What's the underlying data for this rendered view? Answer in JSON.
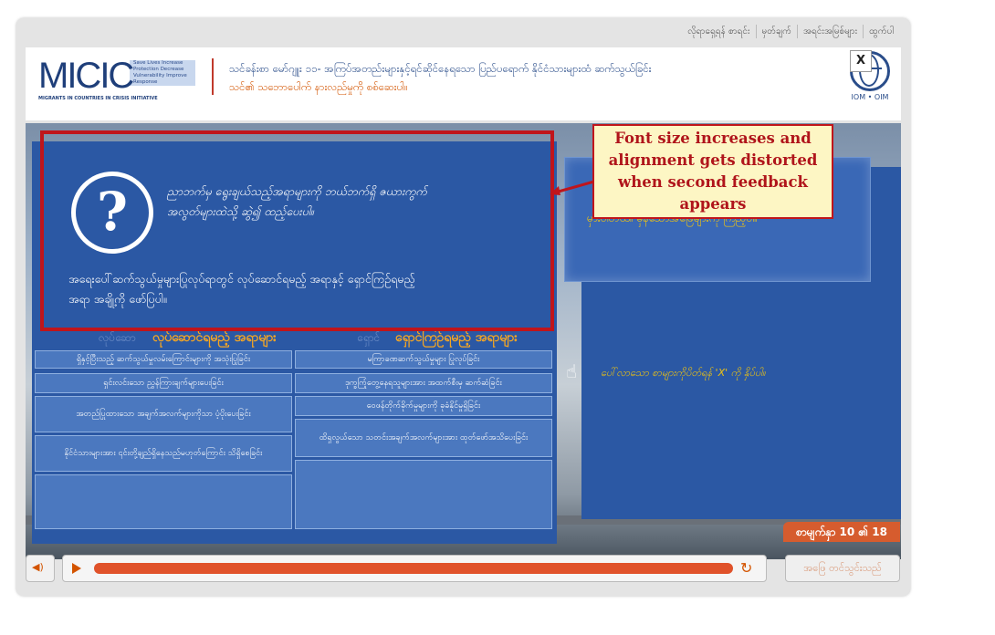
{
  "topnav": [
    "လိုရာရှေ့ရန် စာရင်း",
    "မှတ်ချက်",
    "အရင်းအမြစ်များ",
    "ထွက်ပါ"
  ],
  "logo": {
    "name": "MICIC",
    "tagline": "Save Lives Increase Protection Decrease Vulnerability Improve Response",
    "subtitle": "MIGRANTS IN COUNTRIES IN CRISIS INITIATIVE"
  },
  "header": {
    "title": "သင်ခန်းစာ မော်ဂျူး ၁၁- အကြပ်အတည်းများနှင့်ရင်ဆိုင်နေရသော ပြည်ပရောက် နိုင်ငံသားများထံ ဆက်သွယ်ခြင်း",
    "subtitle": "သင်၏ သဘောပေါက် နားလည်မှုကို စစ်ဆေးပါ။"
  },
  "org_label": "IOM • OIM",
  "question": {
    "prompt": "ညာဘက်မှ ရွေးချယ်သည့်အရာများကို ဘယ်ဘက်ရှိ ဇယားကွက်အလွတ်များထဲသို့ ဆွဲ၍ ထည့်ပေးပါ။",
    "instruction": "အရေးပေါ်ဆက်သွယ်မှုများပြုလုပ်ရာတွင် လုပ်ဆောင်ရမည့် အရာနှင့် ရှောင်ကြဉ်ရမည့်အရာ အချို့ကို ဖော်ပြပါ။",
    "col_do": "လုပ်ဆောင်ရမည့် အရာများ",
    "col_avoid": "ရှောင်ကြဉ်ရမည့် အရာများ",
    "ghost_do": "လုပ်ဆော",
    "ghost_avoid": "ရှောင်",
    "do_items": [
      "ရှိနှင့်ပြီးသည့် ဆက်သွယ်မှုလမ်းကြောင်းများကို အသုံးပြုခြင်း",
      "ရှင်းလင်းသော ညွှန်ကြားချက်များပေးခြင်း",
      "အတည်ပြုထားသော အချက်အလက်များကိုသာ ပံ့ပိုးပေးခြင်း",
      "နိုင်ငံသားများအား ၎င်းတို့ချည်ရှိနေသည်မဟုတ်ကြောင်း သိရှိစေခြင်း"
    ],
    "avoid_items": [
      "မကြာခဏဆက်သွယ်မှုများ ပြုလုပ်ခြင်း",
      "ဒုက္ခကြုံတွေ့နေရသူများအား အထက်စီးမှ ဆက်ဆံခြင်း",
      "ဝေဖန်တိုက်ခိုက်မှုများကို ခုခံနိုင်မှုရှိခြင်း",
      "ထိရှလွယ်သော သတင်းအချက်အလက်များအား ထုတ်ဖော်အသိပေးခြင်း"
    ]
  },
  "feedback": {
    "close_label": "X",
    "message": "မှားပါတယ်။ မှန်သောအဖြေများကို ကြည့်ပါ။",
    "hint": "ပေါ်လာသော စာများကိုပိတ်ရန် 'X' ကို နှိပ်ပါ။"
  },
  "annotation": "Font size increases and alignment gets distorted when second feedback appears",
  "counter": "စာမျက်နှာ 10 ၏ 18",
  "player": {
    "progress": 1.0,
    "submit_label": "အဖြေ တင်သွင်းသည်"
  },
  "colors": {
    "panel": "#2b58a4",
    "accent": "#f5a623",
    "callout_border": "#c0151b",
    "progress": "#e0522a"
  }
}
